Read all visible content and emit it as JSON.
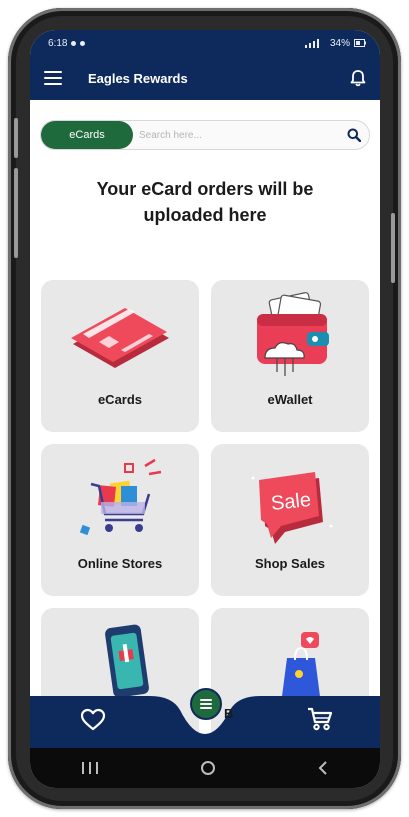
{
  "status_bar": {
    "time": "6:18",
    "battery": "34%"
  },
  "app_bar": {
    "title": "Eagles Rewards"
  },
  "search": {
    "chip_label": "eCards",
    "placeholder": "Search here..."
  },
  "headline": {
    "line1": "Your eCard orders will be",
    "line2": "uploaded here"
  },
  "tiles": [
    {
      "label": "eCards",
      "icon": "credit-card-icon"
    },
    {
      "label": "eWallet",
      "icon": "wallet-icon"
    },
    {
      "label": "Online Stores",
      "icon": "shopping-cart-icon"
    },
    {
      "label": "Shop Sales",
      "icon": "sale-tag-icon"
    },
    {
      "label": "",
      "icon": "phone-gift-icon"
    },
    {
      "label": "",
      "icon": "shopping-bag-icon"
    }
  ],
  "bottom_nav": {
    "peek_text": "B",
    "left_icon": "heart-icon",
    "center_icon": "menu-icon",
    "right_icon": "cart-icon"
  },
  "colors": {
    "primary_navy": "#0e2a5c",
    "accent_green": "#1f6a3d",
    "tile_bg": "#e8e8e8",
    "card_red": "#e8394d"
  }
}
